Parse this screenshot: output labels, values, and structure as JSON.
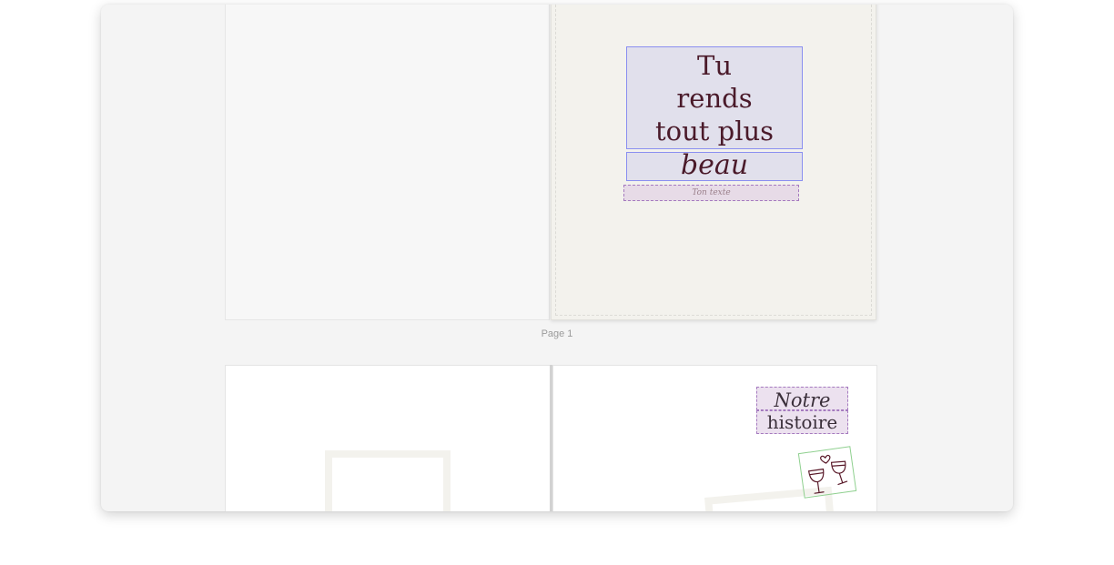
{
  "spread1": {
    "title_lines": [
      "Tu",
      "rends",
      "tout plus"
    ],
    "title_last_line": "beau",
    "subtext_placeholder": "Ton texte",
    "page_label": "Page 1"
  },
  "spread2": {
    "title_line1": "Notre",
    "title_line2": "histoire",
    "sticker_icon": "champagne-glasses-icon"
  },
  "colors": {
    "selection_blue": "#8a8ff0",
    "text_box_purple": "#a57abf",
    "sticker_green": "#8fd08f",
    "title_text": "#4a1a2a",
    "page_cream": "#f3f2ed"
  }
}
